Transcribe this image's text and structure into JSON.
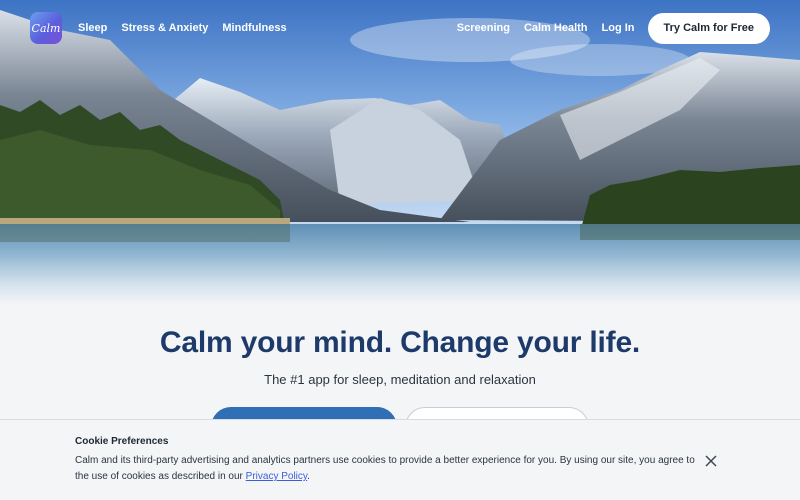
{
  "brand": {
    "logo_text": "Calm",
    "colors": {
      "primary": "#2e6fb5",
      "headline": "#1e3a6b"
    }
  },
  "nav": {
    "left_links": [
      {
        "label": "Sleep"
      },
      {
        "label": "Stress & Anxiety"
      },
      {
        "label": "Mindfulness"
      }
    ],
    "right_links": [
      {
        "label": "Screening"
      },
      {
        "label": "Calm Health"
      },
      {
        "label": "Log In"
      }
    ],
    "cta_label": "Try Calm for Free"
  },
  "hero": {
    "scene": "mountain-lake-landscape"
  },
  "main": {
    "headline": "Calm your mind. Change your life.",
    "subheadline": "The #1 app for sleep, meditation and relaxation"
  },
  "cookie": {
    "title": "Cookie Preferences",
    "text": "Calm and its third-party advertising and analytics partners use cookies to provide a better experience for you. By using our site, you agree to the use of cookies as described in our ",
    "link_label": "Privacy Policy",
    "suffix": ".",
    "close_icon": "close-icon"
  }
}
